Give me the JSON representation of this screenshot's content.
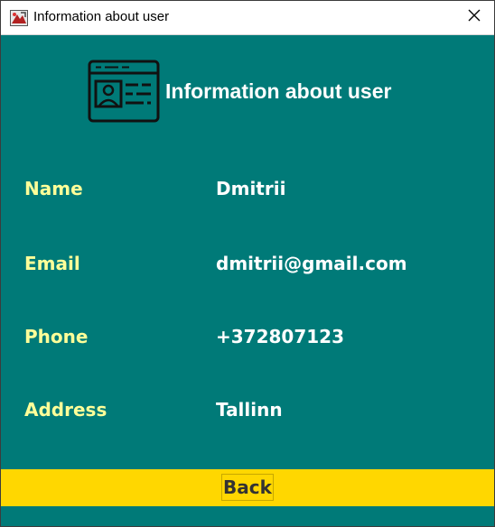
{
  "window": {
    "title": "Information about user",
    "background": "#007a78",
    "close_icon": "close-icon",
    "app_icon": "java-app-icon"
  },
  "header": {
    "icon": "id-card-icon",
    "title": "Information about user"
  },
  "fields": [
    {
      "label": "Name",
      "value": "Dmitrii"
    },
    {
      "label": "Email",
      "value": "dmitrii@gmail.com"
    },
    {
      "label": "Phone",
      "value": "+372807123"
    },
    {
      "label": "Address",
      "value": "Tallinn"
    }
  ],
  "colors": {
    "label": "#ffff99",
    "value": "#ffffff",
    "footer": "#ffd700"
  },
  "footer": {
    "back_label": "Back"
  }
}
